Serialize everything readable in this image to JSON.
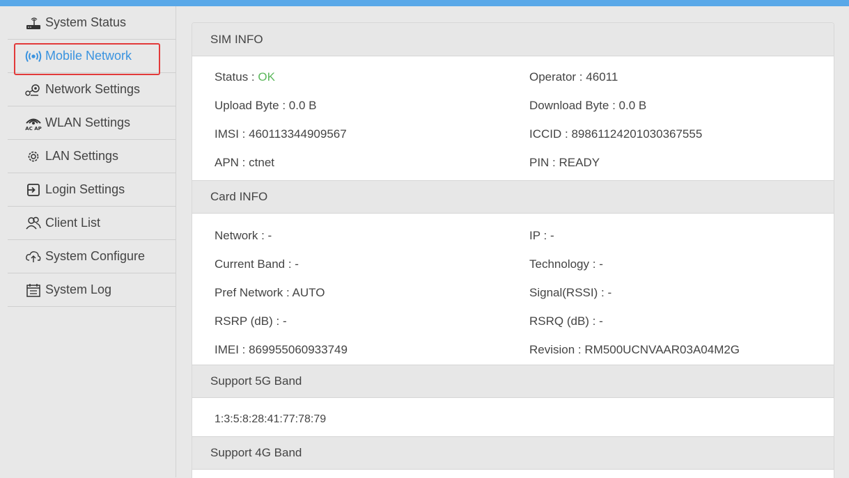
{
  "sidebar": {
    "items": [
      {
        "label": "System Status",
        "icon": "router-icon"
      },
      {
        "label": "Mobile Network",
        "icon": "signal-icon"
      },
      {
        "label": "Network Settings",
        "icon": "network-settings-icon"
      },
      {
        "label": "WLAN Settings",
        "icon": "wlan-icon"
      },
      {
        "label": "LAN Settings",
        "icon": "gear-icon"
      },
      {
        "label": "Login Settings",
        "icon": "login-icon"
      },
      {
        "label": "Client List",
        "icon": "users-icon"
      },
      {
        "label": "System Configure",
        "icon": "upload-cloud-icon"
      },
      {
        "label": "System Log",
        "icon": "calendar-log-icon"
      }
    ],
    "active": "Mobile Network"
  },
  "sim": {
    "title": "SIM INFO",
    "status_label": "Status :",
    "status_value": "OK",
    "operator_label": "Operator :",
    "operator_value": "46011",
    "upload_label": "Upload Byte :",
    "upload_value": "0.0 B",
    "download_label": "Download Byte :",
    "download_value": "0.0 B",
    "imsi_label": "IMSI :",
    "imsi_value": "460113344909567",
    "iccid_label": "ICCID :",
    "iccid_value": "89861124201030367555",
    "apn_label": "APN :",
    "apn_value": "ctnet",
    "pin_label": "PIN :",
    "pin_value": "READY"
  },
  "card": {
    "title": "Card INFO",
    "network_label": "Network :",
    "network_value": "-",
    "ip_label": "IP :",
    "ip_value": "-",
    "band_label": "Current Band :",
    "band_value": "-",
    "tech_label": "Technology :",
    "tech_value": "-",
    "pref_label": "Pref Network :",
    "pref_value": "AUTO",
    "rssi_label": "Signal(RSSI) :",
    "rssi_value": "-",
    "rsrp_label": "RSRP (dB) :",
    "rsrp_value": "-",
    "rsrq_label": "RSRQ (dB) :",
    "rsrq_value": "-",
    "imei_label": "IMEI :",
    "imei_value": "869955060933749",
    "rev_label": "Revision :",
    "rev_value": "RM500UCNVAAR03A04M2G"
  },
  "band5g": {
    "title": "Support 5G Band",
    "value": "1:3:5:8:28:41:77:78:79"
  },
  "band4g": {
    "title": "Support 4G Band"
  },
  "colors": {
    "accent": "#3a93df",
    "ok": "#5cb85c",
    "highlight": "#e23a3a"
  }
}
